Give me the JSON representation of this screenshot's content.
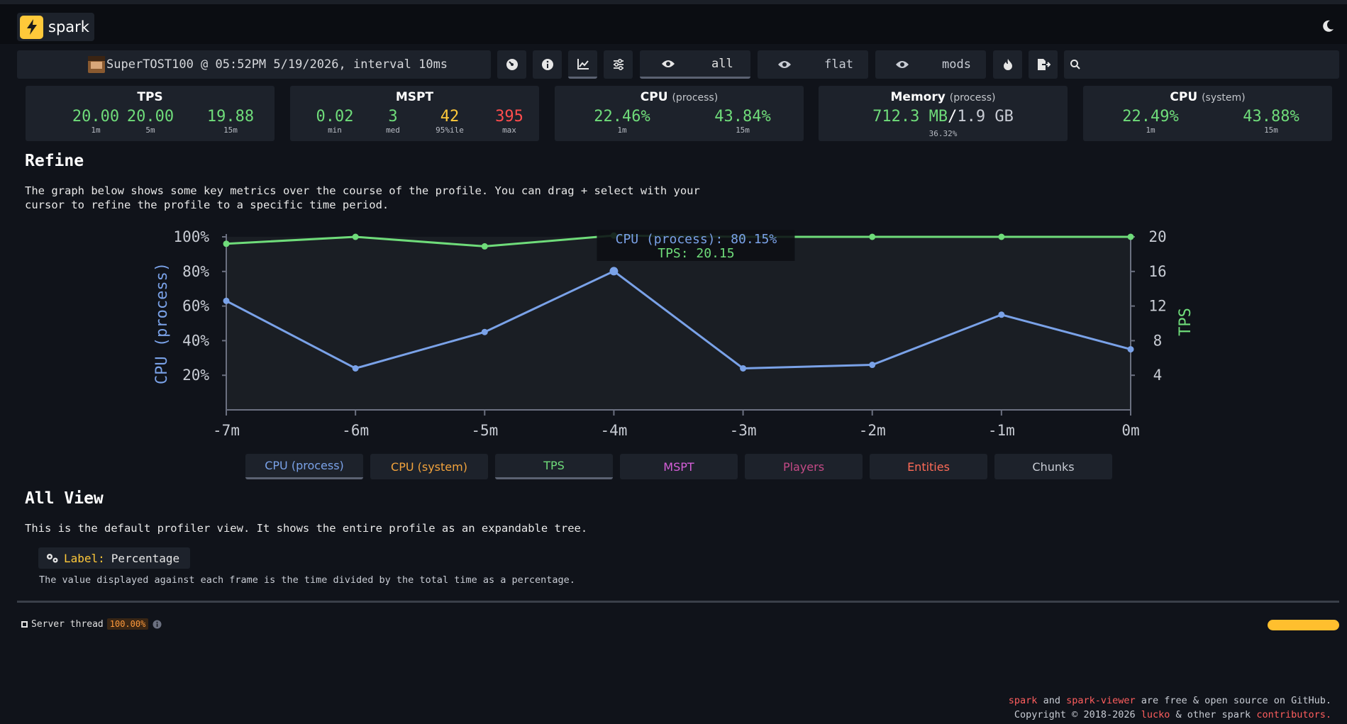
{
  "app": {
    "name": "spark"
  },
  "toolbar": {
    "meta": "SuperTOST100 @ 05:52PM 5/19/2026, interval 10ms",
    "modes": [
      {
        "label": "all"
      },
      {
        "label": "flat"
      },
      {
        "label": "mods"
      }
    ]
  },
  "stats": {
    "tps": {
      "title": "TPS",
      "values": [
        {
          "v": "20.00",
          "l": "1m"
        },
        {
          "v": "20.00",
          "l": "5m"
        },
        {
          "v": "19.88",
          "l": "15m"
        }
      ]
    },
    "mspt": {
      "title": "MSPT",
      "values": [
        {
          "v": "0.02",
          "l": "min"
        },
        {
          "v": "3",
          "l": "med"
        },
        {
          "v": "42",
          "l": "95%ile"
        },
        {
          "v": "395",
          "l": "max"
        }
      ]
    },
    "cpu_process": {
      "title": "CPU",
      "sub": "(process)",
      "values": [
        {
          "v": "22.46%",
          "l": "1m"
        },
        {
          "v": "43.84%",
          "l": "15m"
        }
      ]
    },
    "memory": {
      "title": "Memory",
      "sub": "(process)",
      "used": "712.3 MB",
      "sep": "/",
      "total": "1.9 GB",
      "pct": "36.32%"
    },
    "cpu_system": {
      "title": "CPU",
      "sub": "(system)",
      "values": [
        {
          "v": "22.49%",
          "l": "1m"
        },
        {
          "v": "43.88%",
          "l": "15m"
        }
      ]
    }
  },
  "refine": {
    "title": "Refine",
    "description_line1": "The graph below shows some key metrics over the course of the profile. You can drag + select with your",
    "description_line2": "cursor to refine the profile to a specific time period."
  },
  "chart_data": {
    "type": "line",
    "x": [
      "-7m",
      "-6m",
      "-5m",
      "-4m",
      "-3m",
      "-2m",
      "-1m",
      "0m"
    ],
    "series": [
      {
        "name": "CPU (process)",
        "axis": "left",
        "color": "#7aa2e8",
        "values": [
          63,
          24,
          45,
          80.15,
          24,
          26,
          55,
          35
        ]
      },
      {
        "name": "TPS",
        "axis": "right",
        "color": "#6fdc7a",
        "values": [
          19.2,
          20.0,
          18.9,
          20.15,
          20.0,
          20.0,
          20.0,
          20.0
        ]
      }
    ],
    "ylabel_left": "CPU (process)",
    "ylabel_right": "TPS",
    "ylim_left": [
      0,
      100
    ],
    "yticks_left": [
      "20%",
      "40%",
      "60%",
      "80%",
      "100%"
    ],
    "ylim_right": [
      0,
      20
    ],
    "yticks_right": [
      "4",
      "8",
      "12",
      "16",
      "20"
    ],
    "tooltip": {
      "index": 3,
      "line1": "CPU (process): 80.15%",
      "line2": "TPS: 20.15"
    }
  },
  "legend": [
    {
      "label": "CPU (process)",
      "color": "#7aa2e8",
      "active": true
    },
    {
      "label": "CPU (system)",
      "color": "#f2a33c",
      "active": false
    },
    {
      "label": "TPS",
      "color": "#6fdc7a",
      "active": true
    },
    {
      "label": "MSPT",
      "color": "#d65fd9",
      "active": false
    },
    {
      "label": "Players",
      "color": "#c44a86",
      "active": false
    },
    {
      "label": "Entities",
      "color": "#ff6b57",
      "active": false
    },
    {
      "label": "Chunks",
      "color": "#c8ccd4",
      "active": false
    }
  ],
  "allview": {
    "title": "All View",
    "description": "This is the default profiler view. It shows the entire profile as an expandable tree.",
    "label_key": "Label:",
    "label_value": "Percentage",
    "note": "The value displayed against each frame is the time divided by the total time as a percentage."
  },
  "thread": {
    "name": "Server thread",
    "pct": "100.00%"
  },
  "footer": {
    "spark": "spark",
    "and": "and",
    "viewer": "spark-viewer",
    "rest1": "are free & open source on GitHub.",
    "copyright": "Copyright © 2018-2026",
    "lucko": "lucko",
    "rest2": "& other spark",
    "contributors": "contributors."
  },
  "colors": {
    "green": "#6fdc7a",
    "yellow": "#ffc93a",
    "red": "#ff4d4d",
    "blue": "#7aa2e8"
  }
}
